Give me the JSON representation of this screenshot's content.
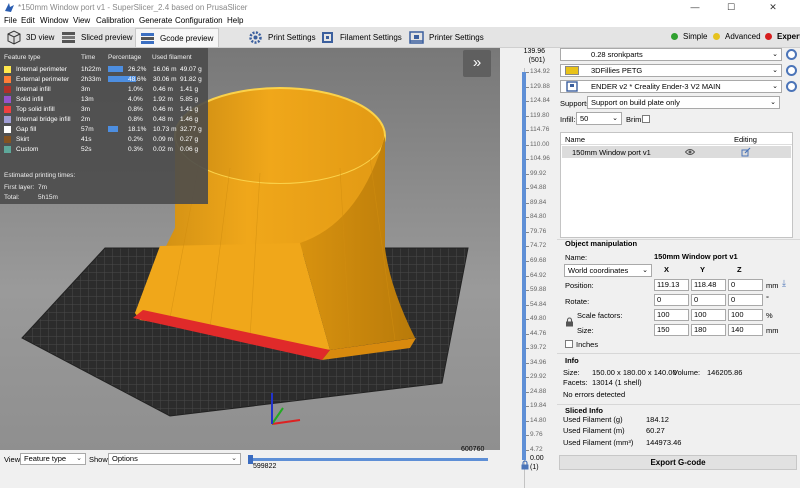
{
  "window": {
    "title": "*150mm Window port v1 - SuperSlicer_2.4 based on PrusaSlicer",
    "minimize_glyph": "—",
    "maximize_glyph": "☐",
    "close_glyph": "✕"
  },
  "menu": [
    "File",
    "Edit",
    "Window",
    "View",
    "Calibration",
    "Generate",
    "Configuration",
    "Help"
  ],
  "tabs": [
    {
      "label": "3D view",
      "icon": "cube-icon"
    },
    {
      "label": "Sliced preview",
      "icon": "layers-icon"
    },
    {
      "label": "Gcode preview",
      "icon": "gcode-layers-icon",
      "active": true
    },
    {
      "label": "Print Settings",
      "icon": "gear-icon"
    },
    {
      "label": "Filament Settings",
      "icon": "spool-icon"
    },
    {
      "label": "Printer Settings",
      "icon": "printer-icon"
    }
  ],
  "modes": [
    {
      "label": "Simple",
      "color": "#2fa02f"
    },
    {
      "label": "Advanced",
      "color": "#e6c21e"
    },
    {
      "label": "Expert",
      "color": "#d61d1d",
      "selected": true
    }
  ],
  "legend": {
    "headers": {
      "feature": "Feature type",
      "time": "Time",
      "percentage": "Percentage",
      "filament": "Used filament"
    },
    "rows": [
      {
        "name": "Internal perimeter",
        "color": "#ffe74d",
        "time": "1h22m",
        "percent": "26.2%",
        "length": "16.06 m",
        "weight": "49.07 g",
        "fraction": 0.262
      },
      {
        "name": "External perimeter",
        "color": "#ff7d38",
        "time": "2h33m",
        "percent": "48.6%",
        "length": "30.06 m",
        "weight": "91.82 g",
        "fraction": 0.486
      },
      {
        "name": "Internal infill",
        "color": "#b03029",
        "time": "3m",
        "percent": "1.0%",
        "length": "0.46 m",
        "weight": "1.41 g",
        "fraction": 0.01
      },
      {
        "name": "Solid infill",
        "color": "#9654cc",
        "time": "13m",
        "percent": "4.0%",
        "length": "1.92 m",
        "weight": "5.85 g",
        "fraction": 0.04
      },
      {
        "name": "Top solid infill",
        "color": "#f04040",
        "time": "3m",
        "percent": "0.8%",
        "length": "0.46 m",
        "weight": "1.41 g",
        "fraction": 0.008
      },
      {
        "name": "Internal bridge infill",
        "color": "#a09dd4",
        "time": "2m",
        "percent": "0.8%",
        "length": "0.48 m",
        "weight": "1.46 g",
        "fraction": 0.008
      },
      {
        "name": "Gap fill",
        "color": "#ffffff",
        "time": "57m",
        "percent": "18.1%",
        "length": "10.73 m",
        "weight": "32.77 g",
        "fraction": 0.181
      },
      {
        "name": "Skirt",
        "color": "#845321",
        "time": "41s",
        "percent": "0.2%",
        "length": "0.09 m",
        "weight": "0.27 g",
        "fraction": 0.002
      },
      {
        "name": "Custom",
        "color": "#5ea89a",
        "time": "52s",
        "percent": "0.3%",
        "length": "0.02 m",
        "weight": "0.06 g",
        "fraction": 0.003
      }
    ],
    "estimated_label": "Estimated printing times:",
    "first_layer_label": "First layer:",
    "first_layer_value": "7m",
    "total_label": "Total:",
    "total_value": "5h15m"
  },
  "collapse_glyph": "»",
  "vslider": {
    "top_value": "139.96",
    "top_layer": "(501)",
    "ticks": [
      "134.92",
      "129.88",
      "124.84",
      "119.80",
      "114.76",
      "110.00",
      "104.96",
      "99.92",
      "94.88",
      "89.84",
      "84.80",
      "79.76",
      "74.72",
      "69.68",
      "64.92",
      "59.88",
      "54.84",
      "49.80",
      "44.76",
      "39.72",
      "34.96",
      "29.92",
      "24.88",
      "19.84",
      "14.80",
      "9.76",
      "4.72"
    ],
    "bottom_value": "0.00",
    "bottom_layer": "(1)"
  },
  "bottom": {
    "view_label": "View",
    "view_value": "Feature type",
    "show_label": "Show",
    "show_value": "Options",
    "hslider_max": "600760",
    "hslider_min": "599822"
  },
  "right": {
    "print_profile": "0.28 sronkparts",
    "filament_profile": "3DFillies PETG",
    "filament_color": "#e8c21a",
    "printer_profile": "ENDER v2 * Creality Ender-3 V2 MAIN",
    "supports_label": "Supports:",
    "supports_value": "Support on build plate only",
    "infill_label": "Infill:",
    "infill_value": "50",
    "brim_label": "Brim:",
    "list_name_header": "Name",
    "list_editing_header": "Editing",
    "object_name": "150mm Window port v1",
    "object_manipulation": {
      "title": "Object manipulation",
      "name_label": "Name:",
      "name_value": "150mm Window port v1",
      "coord_value": "World coordinates",
      "x_header": "X",
      "y_header": "Y",
      "z_header": "Z",
      "position_label": "Position:",
      "position": [
        "119.13",
        "118.48",
        "0"
      ],
      "rotate_label": "Rotate:",
      "rotate": [
        "0",
        "0",
        "0"
      ],
      "scale_label": "Scale factors:",
      "scale": [
        "100",
        "100",
        "100"
      ],
      "size_label": "Size:",
      "size": [
        "150",
        "180",
        "140"
      ],
      "unit_mm": "mm",
      "unit_deg": "°",
      "unit_pct": "%",
      "inches_label": "Inches"
    },
    "info": {
      "title": "Info",
      "size_label": "Size:",
      "size_value": "150.00 x 180.00 x 140.00",
      "volume_label": "Volume:",
      "volume_value": "146205.86",
      "facets_label": "Facets:",
      "facets_value": "13014 (1 shell)",
      "errors": "No errors detected"
    },
    "sliced": {
      "title": "Sliced Info",
      "filament_g_label": "Used Filament (g)",
      "filament_g_value": "184.12",
      "filament_m_label": "Used Filament (m)",
      "filament_m_value": "60.27",
      "filament_mm3_label": "Used Filament (mm³)",
      "filament_mm3_value": "144973.46"
    },
    "export_label": "Export G-code"
  }
}
